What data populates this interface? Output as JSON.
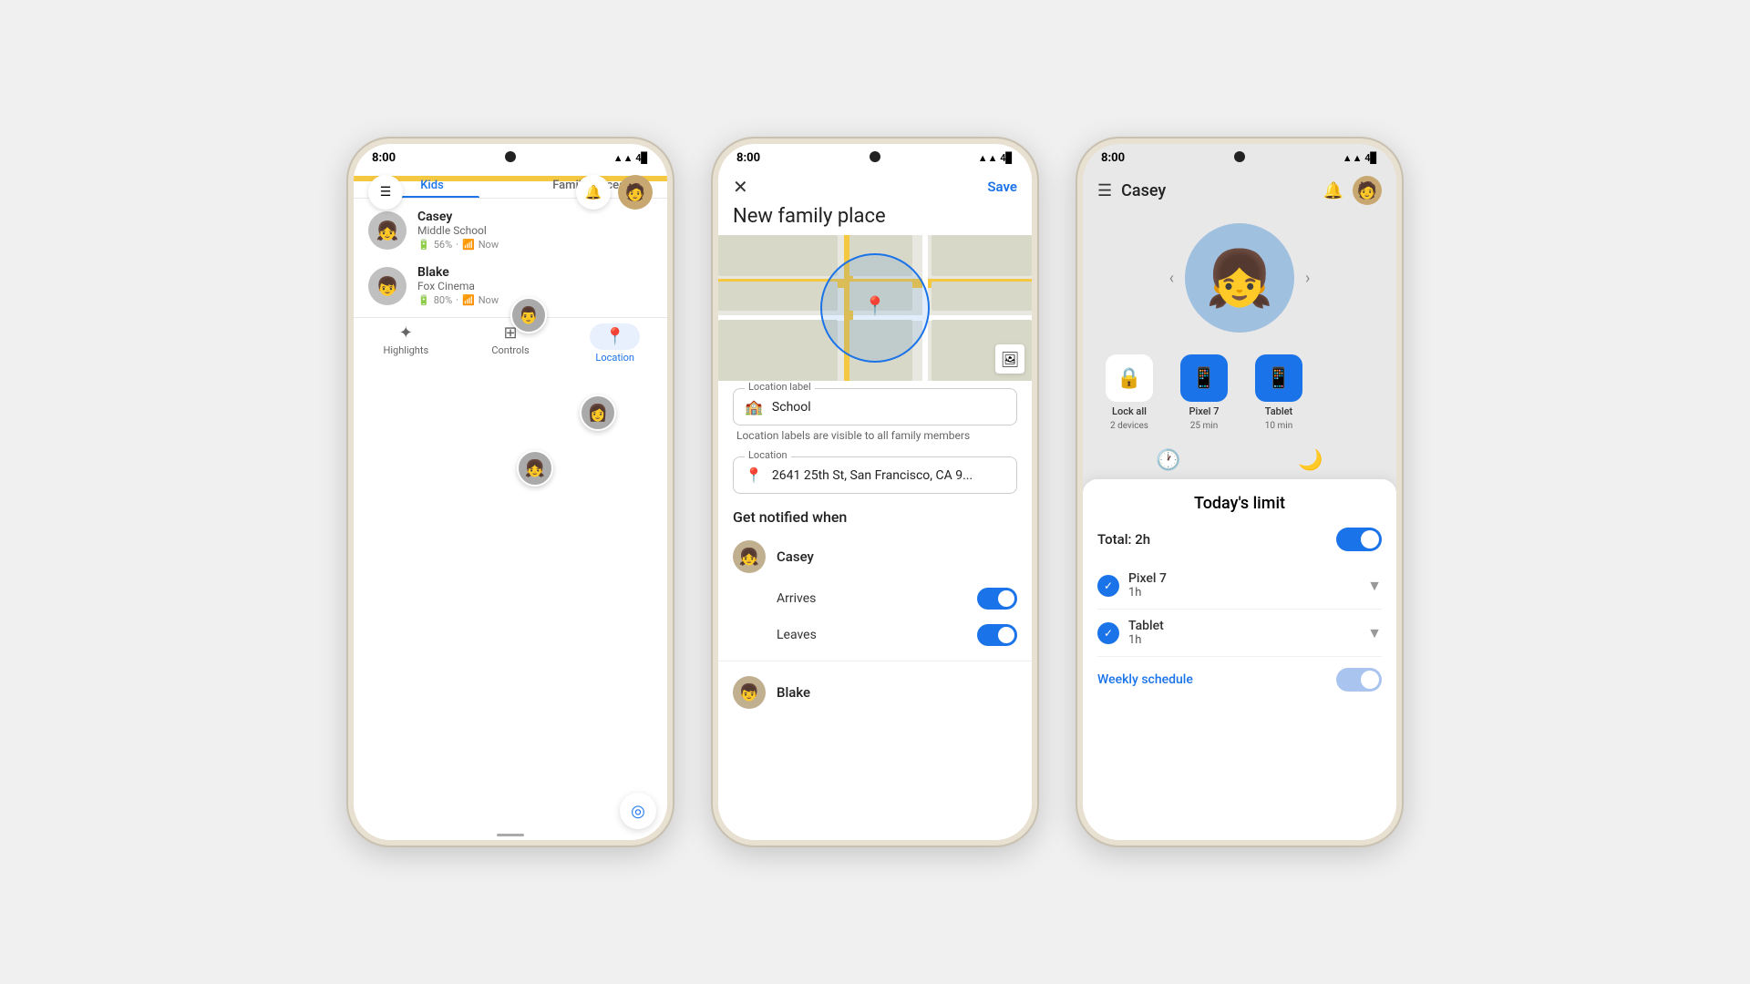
{
  "phone1": {
    "statusBar": {
      "time": "8:00",
      "icons": "▲▲ 4"
    },
    "header": {
      "menuIcon": "☰",
      "bellIcon": "🔔"
    },
    "tabs": [
      "Kids",
      "Family places"
    ],
    "activeTab": "Kids",
    "kids": [
      {
        "name": "Casey",
        "location": "Middle School",
        "battery": "56%",
        "status": "Now",
        "emoji": "👧"
      },
      {
        "name": "Blake",
        "location": "Fox Cinema",
        "battery": "80%",
        "status": "Now",
        "emoji": "👦"
      }
    ],
    "nav": [
      {
        "label": "Highlights",
        "icon": "✦",
        "active": false
      },
      {
        "label": "Controls",
        "icon": "⊞",
        "active": false
      },
      {
        "label": "Location",
        "icon": "📍",
        "active": true
      }
    ]
  },
  "phone2": {
    "statusBar": {
      "time": "8:00"
    },
    "header": {
      "closeIcon": "✕",
      "saveLabel": "Save"
    },
    "title": "New family place",
    "locationLabel": "Location label",
    "locationValue": "School",
    "locationHint": "Location labels are visible to all family members",
    "locationFieldLabel": "Location",
    "locationAddress": "2641 25th St, San Francisco, CA 9...",
    "notifyTitle": "Get notified when",
    "person1": {
      "name": "Casey",
      "emoji": "👧",
      "arrives": {
        "label": "Arrives",
        "on": true
      },
      "leaves": {
        "label": "Leaves",
        "on": true
      }
    },
    "person2": {
      "name": "Blake",
      "emoji": "👦"
    }
  },
  "phone3": {
    "statusBar": {
      "time": "8:00"
    },
    "title": "Casey",
    "menuIcon": "☰",
    "bellIcon": "🔔",
    "profileEmoji": "👧",
    "devices": [
      {
        "name": "Lock all",
        "sub": "2 devices",
        "icon": "🔒",
        "green": false
      },
      {
        "name": "Pixel 7",
        "sub": "25 min",
        "icon": "📱",
        "green": true
      },
      {
        "name": "Tablet",
        "sub": "10 min",
        "icon": "📱",
        "green": true
      }
    ],
    "panel": {
      "title": "Today's limit",
      "total": "Total: 2h",
      "deviceLimits": [
        {
          "name": "Pixel 7",
          "time": "1h"
        },
        {
          "name": "Tablet",
          "time": "1h"
        }
      ],
      "weeklySchedule": "Weekly schedule"
    }
  }
}
